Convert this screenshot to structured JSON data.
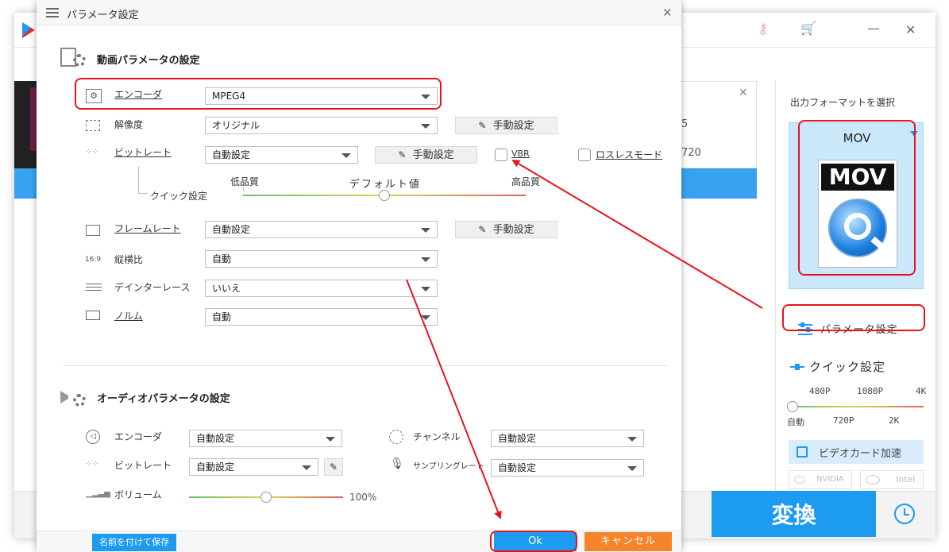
{
  "app": {
    "convert_label": "変換",
    "right_panel": {
      "output_format_title": "出力フォーマットを選択",
      "format_name": "MOV",
      "format_icon_text": "MOV",
      "param_settings_label": "パラメータ設定",
      "quick_settings_label": "クイック設定",
      "quick_ticks_top": [
        "480P",
        "1080P",
        "4K"
      ],
      "quick_ticks_bottom": [
        "自動",
        "720P",
        "2K"
      ],
      "gpu_accel_label": "ビデオカード加速",
      "gpu_nvidia": "NVIDIA",
      "gpu_intel": "Intel"
    },
    "background_fragments": [
      "5",
      "720"
    ]
  },
  "dialog": {
    "title": "パラメータ設定",
    "video_section_title": "動画パラメータの設定",
    "video": {
      "encoder_label": "エンコーダ",
      "encoder_value": "MPEG4",
      "resolution_label": "解像度",
      "resolution_value": "オリジナル",
      "manual_label": "手動設定",
      "bitrate_label": "ビットレート",
      "bitrate_value": "自動設定",
      "vbr_label": "VBR",
      "lossless_label": "ロスレスモード",
      "quick_label": "クイック設定",
      "quality_low": "低品質",
      "quality_default": "デフォルト値",
      "quality_high": "高品質",
      "quality_level": 0.5,
      "framerate_label": "フレームレート",
      "framerate_value": "自動設定",
      "aspect_label": "縦横比",
      "aspect_value": "自動",
      "aspect_icon_text": "16:9",
      "deinterlace_label": "デインターレース",
      "deinterlace_value": "いいえ",
      "norm_label": "ノルム",
      "norm_value": "自動"
    },
    "audio_section_title": "オーディオパラメータの設定",
    "audio": {
      "encoder_label": "エンコーダ",
      "encoder_value": "自動設定",
      "bitrate_label": "ビットレート",
      "bitrate_value": "自動設定",
      "volume_label": "ボリューム",
      "volume_value": "100%",
      "volume_level": 0.5,
      "channel_label": "チャンネル",
      "channel_value": "自動設定",
      "samplerate_label": "サンプリングレート",
      "samplerate_value": "自動設定"
    },
    "save_as_label": "名前を付けて保存",
    "ok_label": "Ok",
    "cancel_label": "キャンセル"
  },
  "colors": {
    "accent_blue": "#1d9bf0",
    "cancel_orange": "#f5842a",
    "annotation_red": "#e8141c"
  }
}
